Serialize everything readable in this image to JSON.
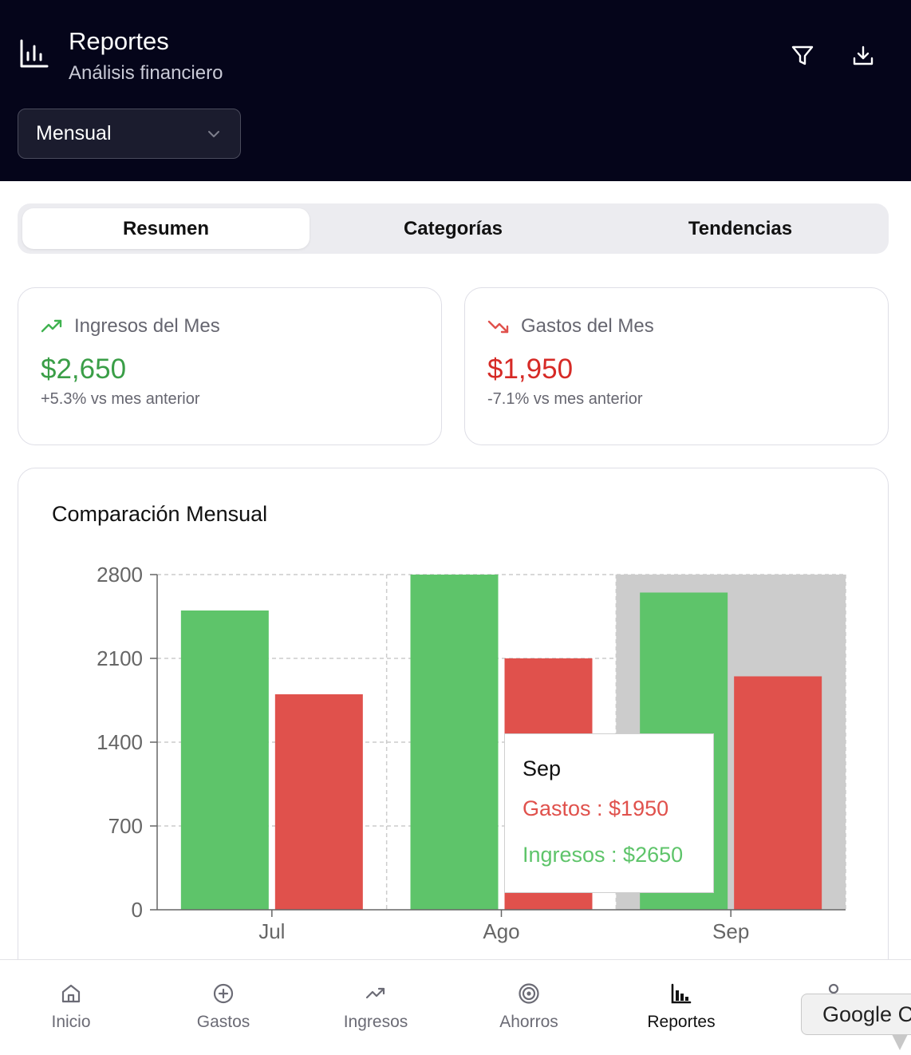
{
  "header": {
    "title": "Reportes",
    "subtitle": "Análisis financiero",
    "icon": "bar-chart-icon",
    "actions": [
      {
        "name": "filter",
        "icon": "filter-icon"
      },
      {
        "name": "download",
        "icon": "download-icon"
      }
    ],
    "period_select": {
      "value": "Mensual"
    }
  },
  "tabs": [
    {
      "label": "Resumen",
      "active": true
    },
    {
      "label": "Categorías",
      "active": false
    },
    {
      "label": "Tendencias",
      "active": false
    }
  ],
  "stats": {
    "income": {
      "label": "Ingresos del Mes",
      "value": "$2,650",
      "delta": "+5.3% vs mes anterior",
      "color": "#3a9e47",
      "icon": "trending-up-icon"
    },
    "expenses": {
      "label": "Gastos del Mes",
      "value": "$1,950",
      "delta": "-7.1% vs mes anterior",
      "color": "#d62a26",
      "icon": "trending-down-icon"
    }
  },
  "chart": {
    "title": "Comparación Mensual",
    "tooltip": {
      "title": "Sep",
      "gastos": "Gastos : $1950",
      "ingresos": "Ingresos : $2650"
    }
  },
  "chart_data": {
    "type": "bar",
    "title": "Comparación Mensual",
    "categories": [
      "Jul",
      "Ago",
      "Sep"
    ],
    "series": [
      {
        "name": "Ingresos",
        "values": [
          2500,
          2800,
          2650
        ],
        "color": "#5ec46a"
      },
      {
        "name": "Gastos",
        "values": [
          1800,
          2100,
          1950
        ],
        "color": "#e0514c"
      }
    ],
    "ylim": [
      0,
      2800
    ],
    "yticks": [
      0,
      700,
      1400,
      2100,
      2800
    ],
    "grid": true,
    "highlighted_category": "Sep"
  },
  "bottom_nav": [
    {
      "label": "Inicio",
      "icon": "home-icon",
      "active": false
    },
    {
      "label": "Gastos",
      "icon": "plus-circle-icon",
      "active": false
    },
    {
      "label": "Ingresos",
      "icon": "trending-up-icon",
      "active": false
    },
    {
      "label": "Ahorros",
      "icon": "target-icon",
      "active": false
    },
    {
      "label": "Reportes",
      "icon": "bar-chart-icon",
      "active": true
    },
    {
      "label": "",
      "icon": "user-icon",
      "active": false
    }
  ],
  "browser_tooltip": {
    "text": "Google C"
  }
}
